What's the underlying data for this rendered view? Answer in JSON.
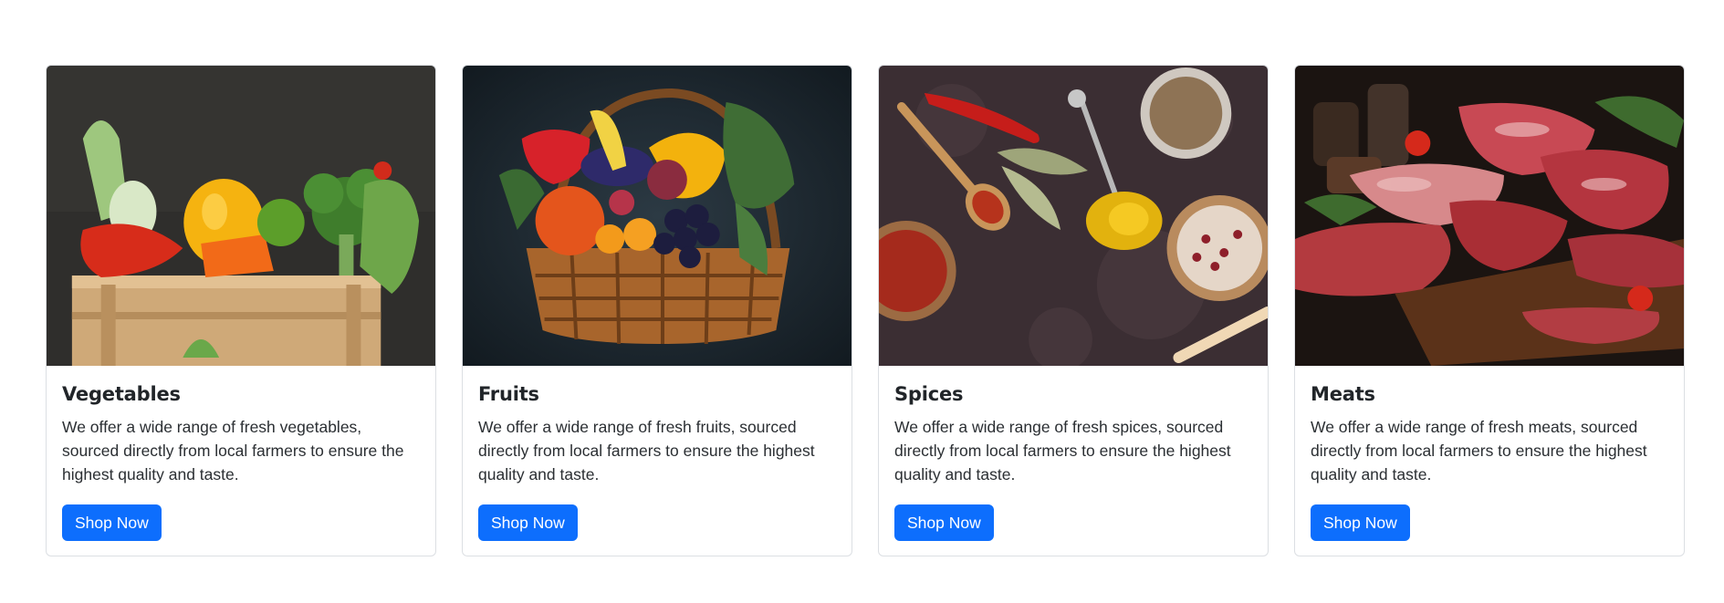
{
  "cards": [
    {
      "title": "Vegetables",
      "text": "We offer a wide range of fresh vegetables, sourced directly from local farmers to ensure the highest quality and taste.",
      "button": "Shop Now",
      "image": "vegetables-crate-photo"
    },
    {
      "title": "Fruits",
      "text": "We offer a wide range of fresh fruits, sourced directly from local farmers to ensure the highest quality and taste.",
      "button": "Shop Now",
      "image": "fruit-basket-photo"
    },
    {
      "title": "Spices",
      "text": "We offer a wide range of fresh spices, sourced directly from local farmers to ensure the highest quality and taste.",
      "button": "Shop Now",
      "image": "spices-table-photo"
    },
    {
      "title": "Meats",
      "text": "We offer a wide range of fresh meats, sourced directly from local farmers to ensure the highest quality and taste.",
      "button": "Shop Now",
      "image": "raw-meats-board-photo"
    }
  ],
  "colors": {
    "button_bg": "#0d6efd",
    "button_text": "#ffffff",
    "card_border": "#dcdfe3"
  }
}
